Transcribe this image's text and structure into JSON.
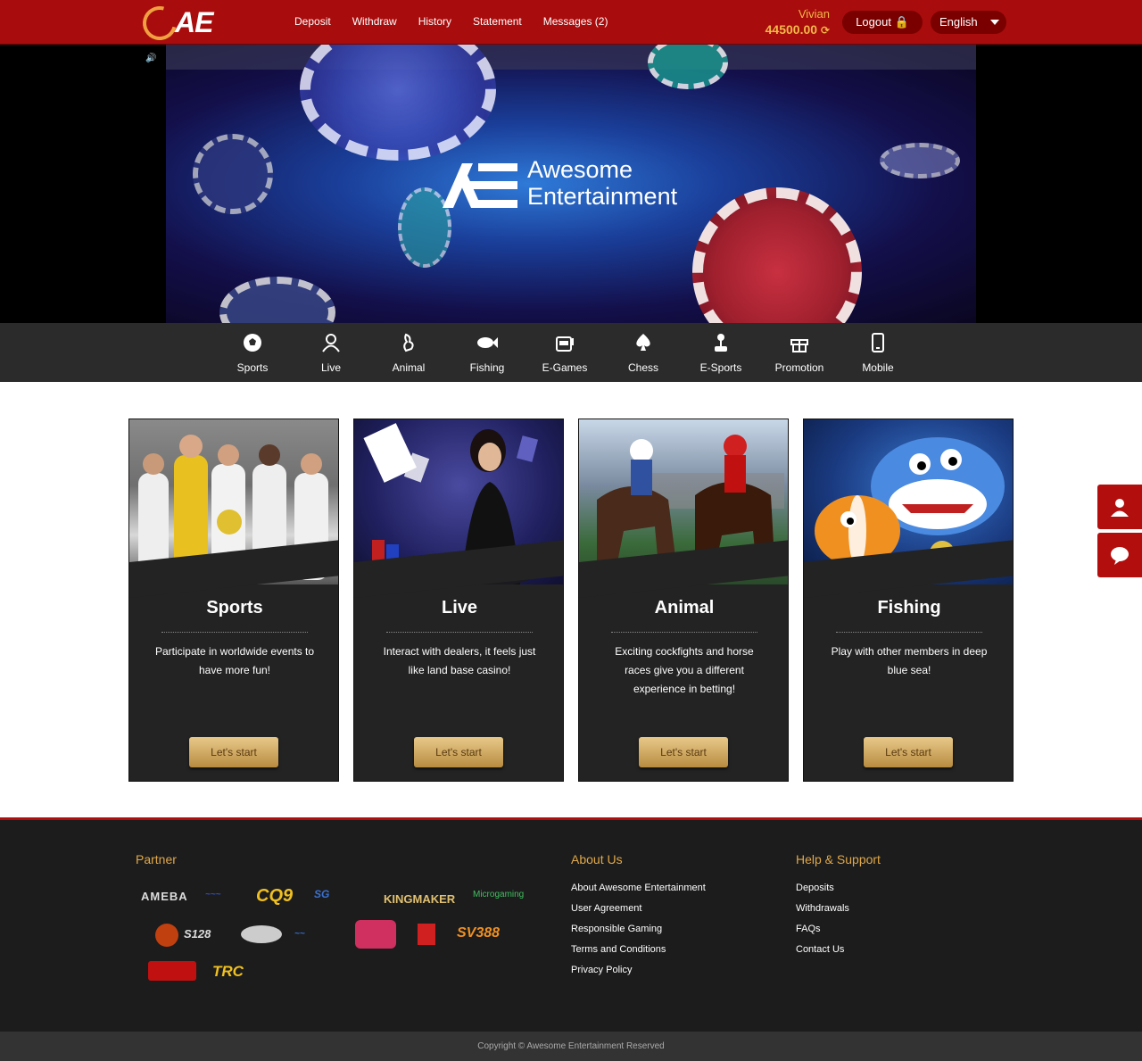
{
  "header": {
    "logo_text": "AE",
    "nav": [
      "Deposit",
      "Withdraw",
      "History",
      "Statement",
      "Messages (2)"
    ],
    "username": "Vivian",
    "balance": "44500.00",
    "logout_label": "Logout",
    "language": "English"
  },
  "banner": {
    "line1": "Awesome",
    "line2": "Entertainment"
  },
  "categories": [
    "Sports",
    "Live",
    "Animal",
    "Fishing",
    "E-Games",
    "Chess",
    "E-Sports",
    "Promotion",
    "Mobile"
  ],
  "cards": [
    {
      "title": "Sports",
      "desc": "Participate in worldwide events to have more fun!",
      "button": "Let's start"
    },
    {
      "title": "Live",
      "desc": "Interact with dealers, it feels just like land base casino!",
      "button": "Let's start"
    },
    {
      "title": "Animal",
      "desc": "Exciting cockfights and horse races give you a different experience in betting!",
      "button": "Let's start"
    },
    {
      "title": "Fishing",
      "desc": "Play with other members in deep blue sea!",
      "button": "Let's start"
    }
  ],
  "footer": {
    "partner_heading": "Partner",
    "partners": [
      "AMEBA",
      "CQ9",
      "KINGMAKER",
      "Microgaming",
      "S128",
      "SV388",
      "TRC"
    ],
    "about_heading": "About Us",
    "about_links": [
      "About Awesome Entertainment",
      "User Agreement",
      "Responsible Gaming",
      "Terms and Conditions",
      "Privacy Policy"
    ],
    "help_heading": "Help & Support",
    "help_links": [
      "Deposits",
      "Withdrawals",
      "FAQs",
      "Contact Us"
    ],
    "copyright": "Copyright © Awesome Entertainment Reserved"
  }
}
